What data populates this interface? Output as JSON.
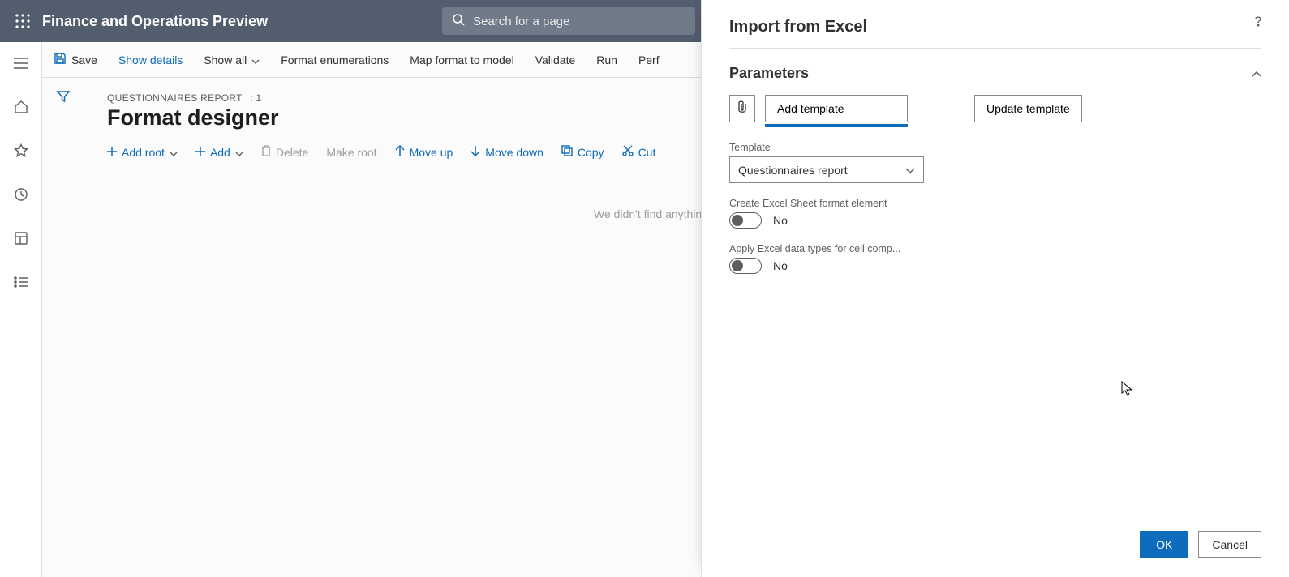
{
  "topbar": {
    "app_title": "Finance and Operations Preview",
    "search_placeholder": "Search for a page"
  },
  "actionbar": {
    "save": "Save",
    "show_details": "Show details",
    "show_all": "Show all",
    "format_enumerations": "Format enumerations",
    "map_format": "Map format to model",
    "validate": "Validate",
    "run": "Run",
    "perf": "Perf"
  },
  "designer": {
    "breadcrumb_title": "QUESTIONNAIRES REPORT",
    "breadcrumb_index": ": 1",
    "page_title": "Format designer",
    "toolbar": {
      "add_root": "Add root",
      "add": "Add",
      "delete": "Delete",
      "make_root": "Make root",
      "move_up": "Move up",
      "move_down": "Move down",
      "copy": "Copy",
      "cut": "Cut"
    },
    "empty_message": "We didn't find anything to show here."
  },
  "panel": {
    "title": "Import from Excel",
    "parameters_heading": "Parameters",
    "add_template": "Add template",
    "update_template": "Update template",
    "template_label": "Template",
    "template_value": "Questionnaires report",
    "create_sheet_label": "Create Excel Sheet format element",
    "create_sheet_value": "No",
    "apply_types_label": "Apply Excel data types for cell comp...",
    "apply_types_value": "No",
    "ok": "OK",
    "cancel": "Cancel"
  }
}
